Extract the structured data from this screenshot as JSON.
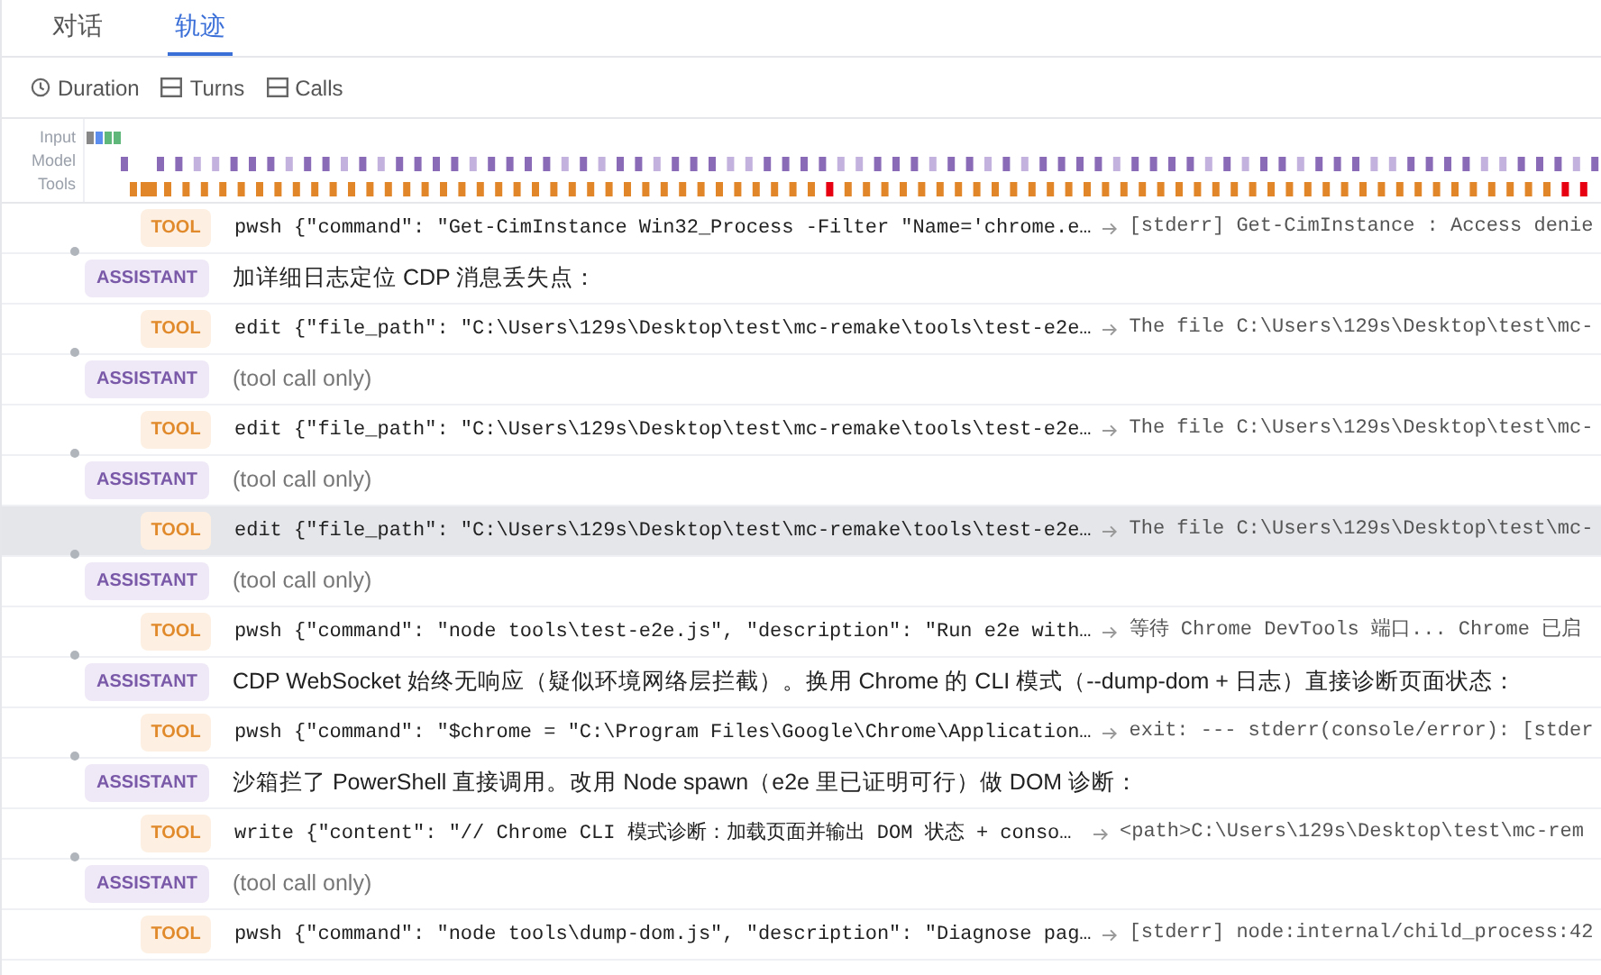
{
  "tabs": [
    {
      "label": "对话",
      "selected": false
    },
    {
      "label": "轨迹",
      "selected": true
    }
  ],
  "toolbar": [
    {
      "kind": "clock",
      "label": "Duration"
    },
    {
      "kind": "split",
      "label": "Turns"
    },
    {
      "kind": "split",
      "label": "Calls"
    }
  ],
  "timeline": {
    "labels": [
      "Input",
      "Model",
      "Tools"
    ]
  },
  "rows": [
    {
      "kind": "tool",
      "badge": "TOOL",
      "name": "pwsh",
      "args": "{\"command\": \"Get-CimInstance Win32_Process -Filter \"Name='chrome.e…",
      "result": "[stderr] Get-CimInstance : Access denie",
      "selected": false
    },
    {
      "kind": "assistant",
      "badge": "ASSISTANT",
      "text": "加详细日志定位 CDP 消息丢失点：",
      "muted": false,
      "selected": false
    },
    {
      "kind": "tool",
      "badge": "TOOL",
      "name": "edit",
      "args": "{\"file_path\": \"C:\\Users\\129s\\Desktop\\test\\mc-remake\\tools\\test-e2e…",
      "result": "The file C:\\Users\\129s\\Desktop\\test\\mc-",
      "selected": false
    },
    {
      "kind": "assistant",
      "badge": "ASSISTANT",
      "text": "(tool call only)",
      "muted": true,
      "selected": false
    },
    {
      "kind": "tool",
      "badge": "TOOL",
      "name": "edit",
      "args": "{\"file_path\": \"C:\\Users\\129s\\Desktop\\test\\mc-remake\\tools\\test-e2e…",
      "result": "The file C:\\Users\\129s\\Desktop\\test\\mc-",
      "selected": false
    },
    {
      "kind": "assistant",
      "badge": "ASSISTANT",
      "text": "(tool call only)",
      "muted": true,
      "selected": false
    },
    {
      "kind": "tool",
      "badge": "TOOL",
      "name": "edit",
      "args": "{\"file_path\": \"C:\\Users\\129s\\Desktop\\test\\mc-remake\\tools\\test-e2e…",
      "result": "The file C:\\Users\\129s\\Desktop\\test\\mc-",
      "selected": true
    },
    {
      "kind": "assistant",
      "badge": "ASSISTANT",
      "text": "(tool call only)",
      "muted": true,
      "selected": false
    },
    {
      "kind": "tool",
      "badge": "TOOL",
      "name": "pwsh",
      "args": "{\"command\": \"node tools\\test-e2e.js\", \"description\": \"Run e2e with…",
      "result": "等待 Chrome DevTools 端口... Chrome 已启",
      "selected": false
    },
    {
      "kind": "assistant",
      "badge": "ASSISTANT",
      "text": "CDP WebSocket 始终无响应（疑似环境网络层拦截）。换用 Chrome 的 CLI 模式（--dump-dom + 日志）直接诊断页面状态：",
      "muted": false,
      "selected": false
    },
    {
      "kind": "tool",
      "badge": "TOOL",
      "name": "pwsh",
      "args": "{\"command\": \"$chrome = \"C:\\Program Files\\Google\\Chrome\\Application…",
      "result": "exit: --- stderr(console/error): [stder",
      "selected": false
    },
    {
      "kind": "assistant",
      "badge": "ASSISTANT",
      "text": "沙箱拦了 PowerShell 直接调用。改用 Node spawn（e2e 里已证明可行）做 DOM 诊断：",
      "muted": false,
      "selected": false
    },
    {
      "kind": "tool",
      "badge": "TOOL",
      "name": "write",
      "args": "{\"content\": \"// Chrome CLI 模式诊断：加载页面并输出 DOM 状态 + conso…",
      "result": "<path>C:\\Users\\129s\\Desktop\\test\\mc-rem",
      "selected": false
    },
    {
      "kind": "assistant",
      "badge": "ASSISTANT",
      "text": "(tool call only)",
      "muted": true,
      "selected": false
    },
    {
      "kind": "tool",
      "badge": "TOOL",
      "name": "pwsh",
      "args": "{\"command\": \"node tools\\dump-dom.js\", \"description\": \"Diagnose pag…",
      "result": "[stderr] node:internal/child_process:42",
      "selected": false
    }
  ]
}
